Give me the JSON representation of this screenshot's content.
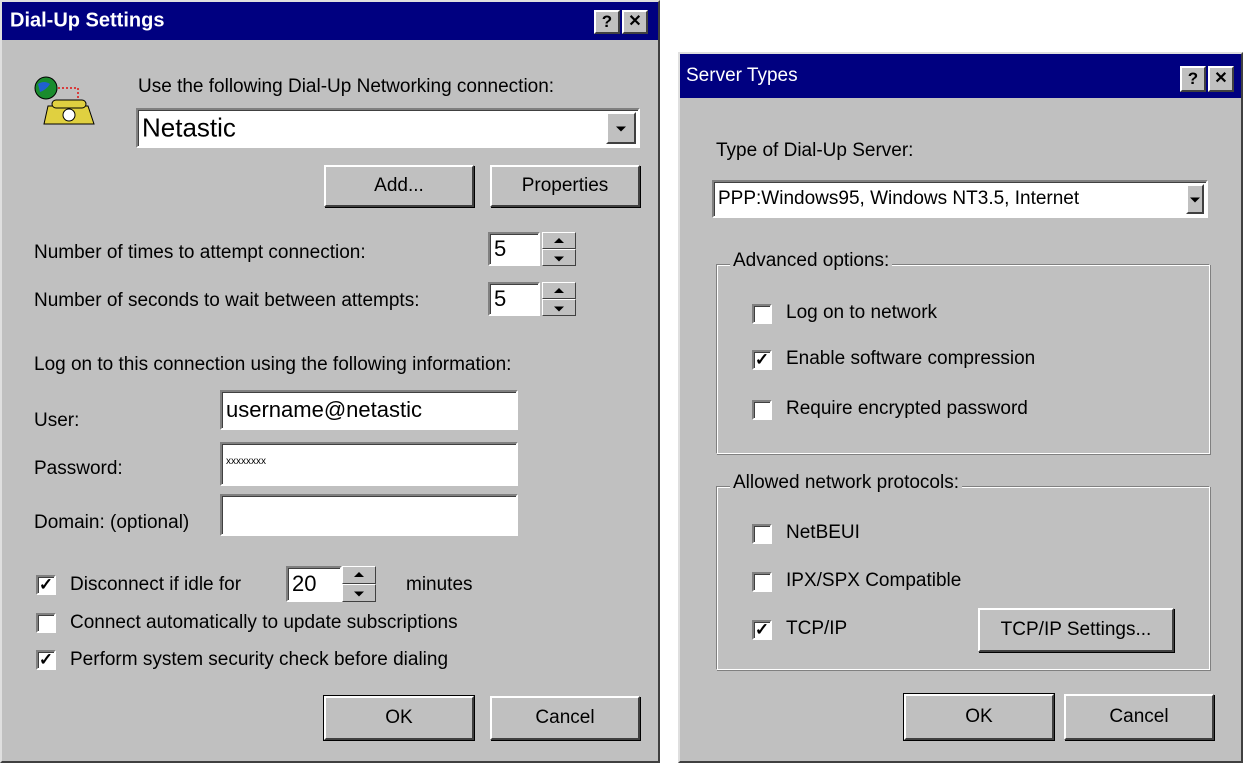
{
  "dialup": {
    "title": "Dial-Up Settings",
    "help_btn": "?",
    "close_btn": "✕",
    "connection_label": "Use the following Dial-Up Networking connection:",
    "connection_value": "Netastic",
    "add_label": "Add...",
    "properties_label": "Properties",
    "attempts_label": "Number of times to attempt connection:",
    "attempts_value": "5",
    "wait_label": "Number of seconds to wait between attempts:",
    "wait_value": "5",
    "logon_label": "Log on to this connection using the following information:",
    "user_label": "User:",
    "user_value": "username@netastic",
    "password_label": "Password:",
    "password_value": "xxxxxxxx",
    "domain_label": "Domain: (optional)",
    "domain_value": "",
    "idle_check_label": "Disconnect if idle for",
    "idle_value": "20",
    "idle_unit": "minutes",
    "idle_checked": true,
    "auto_connect_label": "Connect automatically to update subscriptions",
    "auto_connect_checked": false,
    "security_label": "Perform system security check before dialing",
    "security_checked": true,
    "ok_label": "OK",
    "cancel_label": "Cancel"
  },
  "server": {
    "title": "Server Types",
    "help_btn": "?",
    "close_btn": "✕",
    "type_label": "Type of Dial-Up Server:",
    "type_value": "PPP:Windows95, Windows NT3.5, Internet",
    "advanced_label": "Advanced options:",
    "logon_network_label": "Log on to network",
    "logon_network_checked": false,
    "compression_label": "Enable software compression",
    "compression_checked": true,
    "encrypted_label": "Require encrypted password",
    "encrypted_checked": false,
    "protocols_label": "Allowed network protocols:",
    "netbeui_label": "NetBEUI",
    "netbeui_checked": false,
    "ipx_label": "IPX/SPX Compatible",
    "ipx_checked": false,
    "tcpip_label": "TCP/IP",
    "tcpip_checked": true,
    "tcpip_settings_label": "TCP/IP Settings...",
    "ok_label": "OK",
    "cancel_label": "Cancel"
  },
  "colors": {
    "title_bar": "#000080",
    "dialog_face": "#c0c0c0"
  }
}
